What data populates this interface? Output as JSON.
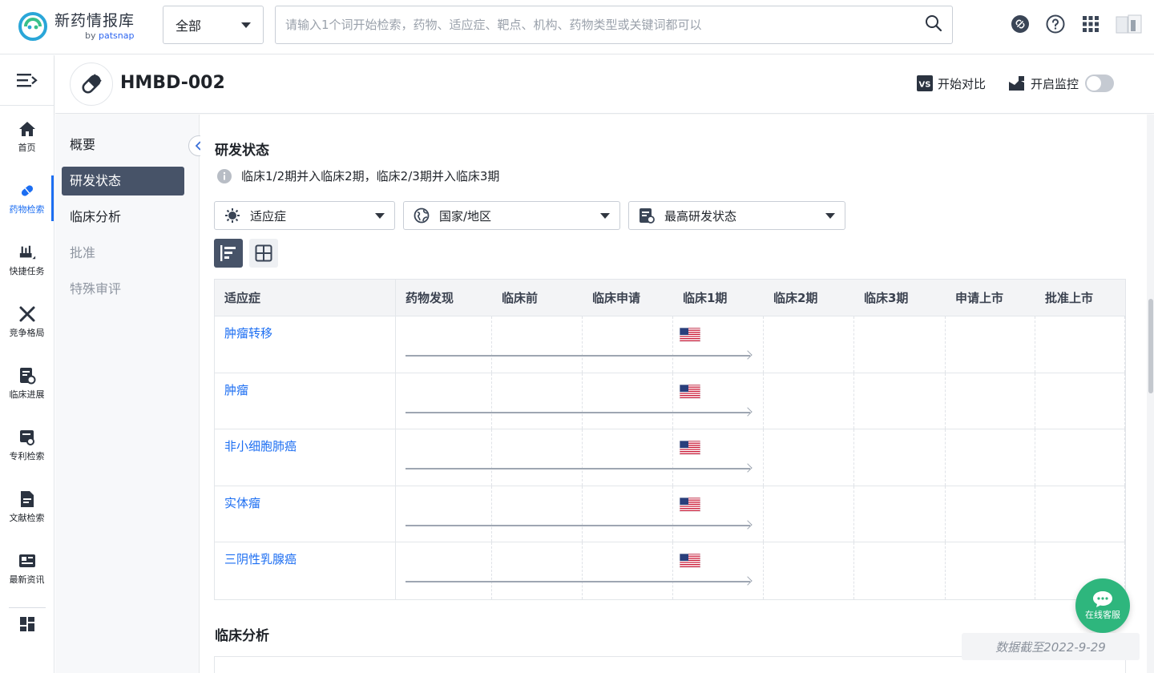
{
  "app": {
    "name": "新药情报库",
    "by": "by",
    "brand": "patsnap"
  },
  "search": {
    "scope": "全部",
    "placeholder": "请输入1个词开始检索，药物、适应症、靶点、机构、药物类型或关键词都可以"
  },
  "leftnav": {
    "items": [
      {
        "label": "首页",
        "icon": "home-icon"
      },
      {
        "label": "药物检索",
        "icon": "pill-icon",
        "active": true
      },
      {
        "label": "快捷任务",
        "icon": "task-icon"
      },
      {
        "label": "竞争格局",
        "icon": "swords-icon"
      },
      {
        "label": "临床进展",
        "icon": "clinical-icon"
      },
      {
        "label": "专利检索",
        "icon": "patent-icon"
      },
      {
        "label": "文献检索",
        "icon": "document-icon"
      },
      {
        "label": "最新资讯",
        "icon": "news-icon"
      }
    ]
  },
  "drug": {
    "name": "HMBD-002",
    "compare_label": "开始对比",
    "monitor_label": "开启监控",
    "monitor_on": false
  },
  "subnav": {
    "items": [
      {
        "label": "概要",
        "state": "normal"
      },
      {
        "label": "研发状态",
        "state": "active"
      },
      {
        "label": "临床分析",
        "state": "normal"
      },
      {
        "label": "批准",
        "state": "disabled"
      },
      {
        "label": "特殊审评",
        "state": "disabled"
      }
    ]
  },
  "rd": {
    "title": "研发状态",
    "note": "临床1/2期并入临床2期，临床2/3期并入临床3期",
    "filters": [
      {
        "label": "适应症",
        "icon": "virus-icon"
      },
      {
        "label": "国家/地区",
        "icon": "globe-icon"
      },
      {
        "label": "最高研发状态",
        "icon": "status-doc-icon"
      }
    ],
    "columns": [
      "适应症",
      "药物发现",
      "临床前",
      "临床申请",
      "临床1期",
      "临床2期",
      "临床3期",
      "申请上市",
      "批准上市"
    ],
    "rows": [
      {
        "indication": "肿瘤转移",
        "highest_phase": "临床1期",
        "country": "US"
      },
      {
        "indication": "肿瘤",
        "highest_phase": "临床1期",
        "country": "US"
      },
      {
        "indication": "非小细胞肺癌",
        "highest_phase": "临床1期",
        "country": "US"
      },
      {
        "indication": "实体瘤",
        "highest_phase": "临床1期",
        "country": "US"
      },
      {
        "indication": "三阴性乳腺癌",
        "highest_phase": "临床1期",
        "country": "US"
      }
    ]
  },
  "clinical": {
    "title": "临床分析"
  },
  "chat": {
    "label": "在线客服"
  },
  "data_cutoff": "数据截至2022-9-29",
  "colors": {
    "accent": "#1c6ef2",
    "active_nav": "#475368",
    "chat": "#2eb67d"
  }
}
